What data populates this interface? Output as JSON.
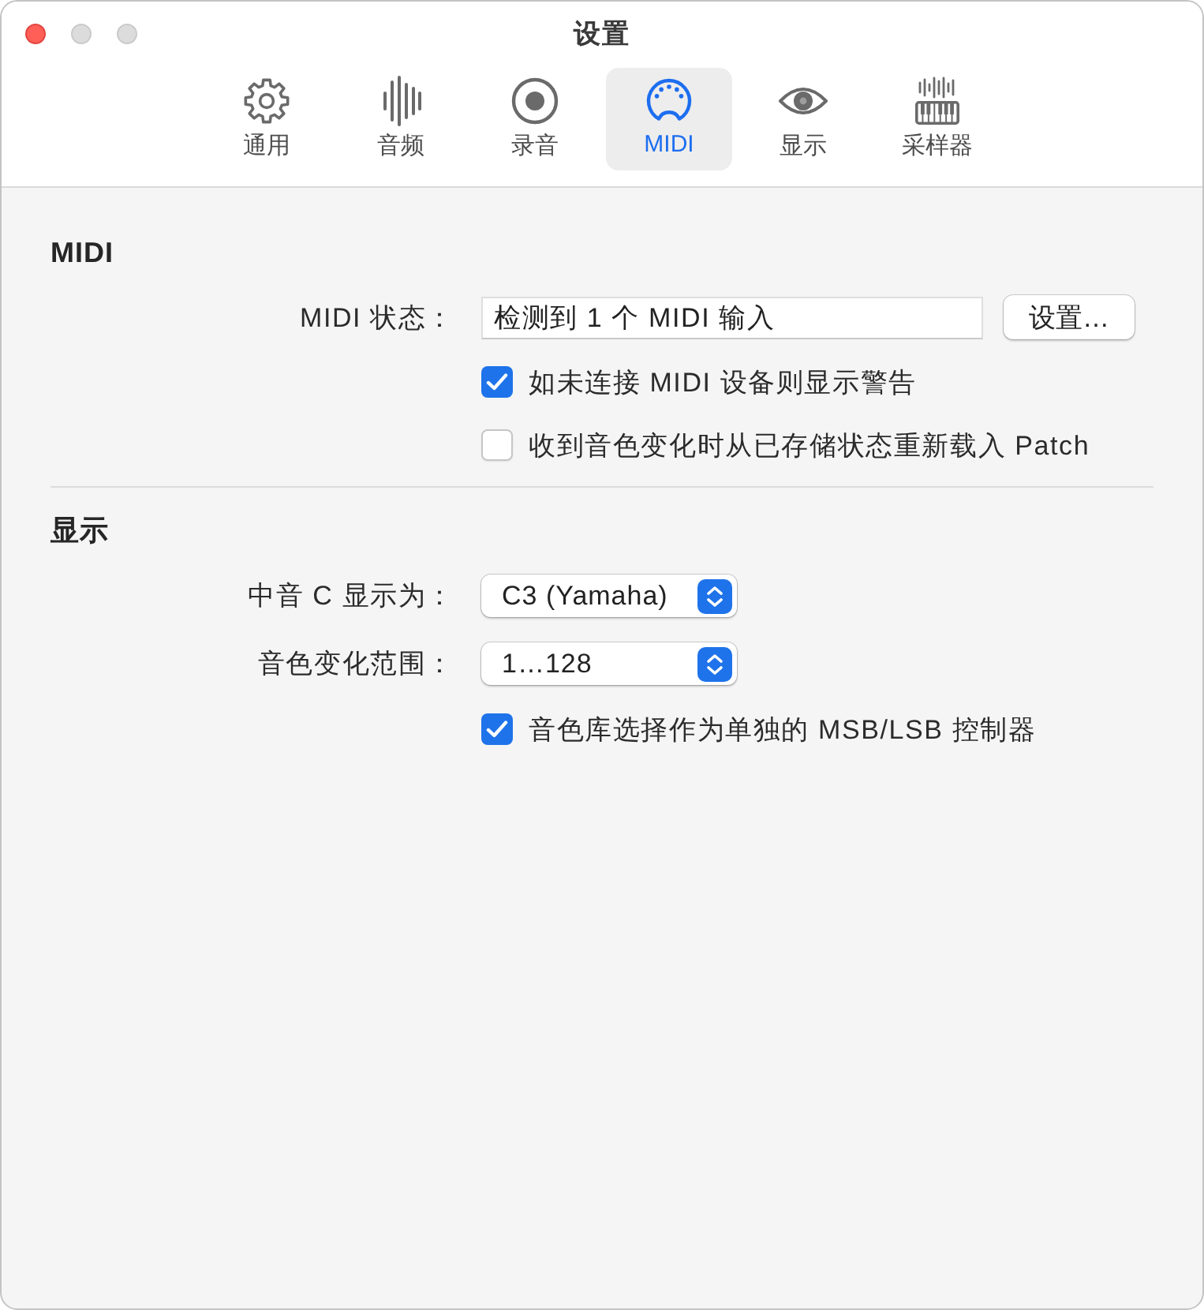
{
  "window": {
    "title": "设置"
  },
  "tabs": [
    {
      "label": "通用",
      "selected": false
    },
    {
      "label": "音频",
      "selected": false
    },
    {
      "label": "录音",
      "selected": false
    },
    {
      "label": "MIDI",
      "selected": true
    },
    {
      "label": "显示",
      "selected": false
    },
    {
      "label": "采样器",
      "selected": false
    }
  ],
  "sections": [
    {
      "title": "MIDI",
      "rows": [
        {
          "kind": "field",
          "label": "MIDI 状态：",
          "value": "检测到 1 个 MIDI 输入",
          "button": "设置…"
        },
        {
          "kind": "checkbox",
          "label": "如未连接 MIDI 设备则显示警告",
          "checked": true
        },
        {
          "kind": "checkbox",
          "label": "收到音色变化时从已存储状态重新载入 Patch",
          "checked": false
        }
      ]
    },
    {
      "title": "显示",
      "rows": [
        {
          "kind": "popup",
          "label": "中音 C 显示为：",
          "value": "C3 (Yamaha)"
        },
        {
          "kind": "popup",
          "label": "音色变化范围：",
          "value": "1…128"
        },
        {
          "kind": "checkbox",
          "label": "音色库选择作为单独的 MSB/LSB 控制器",
          "checked": true
        }
      ]
    }
  ]
}
